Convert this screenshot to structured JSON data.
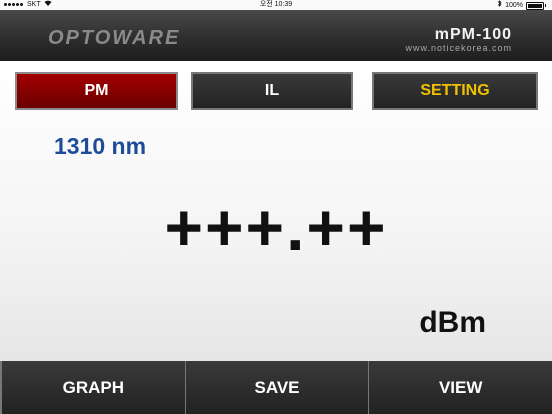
{
  "status_bar": {
    "carrier": "SKT",
    "time": "오전 10:39",
    "battery": "100%"
  },
  "header": {
    "brand": "OPTOWARE",
    "model": "mPM-100",
    "website": "www.noticekorea.com"
  },
  "tabs": [
    {
      "label": "PM",
      "active": true
    },
    {
      "label": "IL",
      "active": false
    },
    {
      "label": "SETTING",
      "active": false
    }
  ],
  "measurement": {
    "wavelength": "1310 nm",
    "reading": "+++.++",
    "unit": "dBm"
  },
  "bottom_bar": [
    {
      "label": "GRAPH"
    },
    {
      "label": "SAVE"
    },
    {
      "label": "VIEW"
    }
  ],
  "colors": {
    "active_tab": "#8b0000",
    "setting_text": "#f2c100",
    "wavelength_text": "#1d4c9a"
  }
}
